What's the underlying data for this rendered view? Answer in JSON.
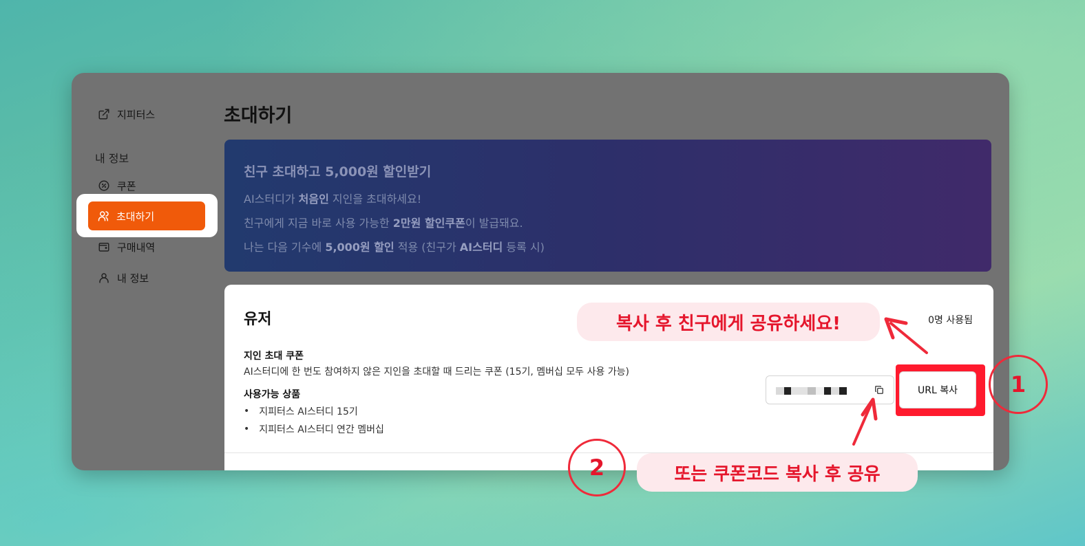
{
  "sidebar": {
    "external_link": "지피터스",
    "section_title": "내 정보",
    "items": [
      {
        "label": "쿠폰",
        "icon": "coupon-icon"
      },
      {
        "label": "초대하기",
        "icon": "users-icon",
        "active": true
      },
      {
        "label": "구매내역",
        "icon": "wallet-icon"
      },
      {
        "label": "내 정보",
        "icon": "user-icon"
      }
    ]
  },
  "page": {
    "title": "초대하기"
  },
  "banner": {
    "title": "친구 초대하고 5,000원 할인받기",
    "line1": {
      "pre": "AI스터디가 ",
      "bold": "처음인",
      "post": " 지인을 초대하세요!"
    },
    "line2": {
      "pre": "친구에게 지금 바로 사용 가능한 ",
      "bold": "2만원 할인쿠폰",
      "post": "이 발급돼요."
    },
    "line3": {
      "pre": "나는 다음 기수에 ",
      "bold": "5,000원 할인",
      "mid": " 적용 (친구가 ",
      "bold2": "AI스터디",
      "post": " 등록 시)"
    }
  },
  "card": {
    "title": "유저",
    "used": "0명 사용됨",
    "coupon_label": "지인 초대 쿠폰",
    "coupon_desc": "AI스터디에 한 번도 참여하지 않은 지인을 초대할 때 드리는 쿠폰 (15기, 멤버십 모두 사용 가능)",
    "products_label": "사용가능 상품",
    "products": [
      "지피터스 AI스터디 15기",
      "지피터스 AI스터디 연간 멤버십"
    ],
    "url_copy_button": "URL 복사"
  },
  "annotations": {
    "callout1": "복사 후 친구에게 공유하세요!",
    "callout2": "또는 쿠폰코드 복사 후 공유",
    "num1": "1",
    "num2": "2",
    "accent": "#e5162c"
  },
  "colors": {
    "active": "#f05a0a",
    "window": "#727272"
  }
}
